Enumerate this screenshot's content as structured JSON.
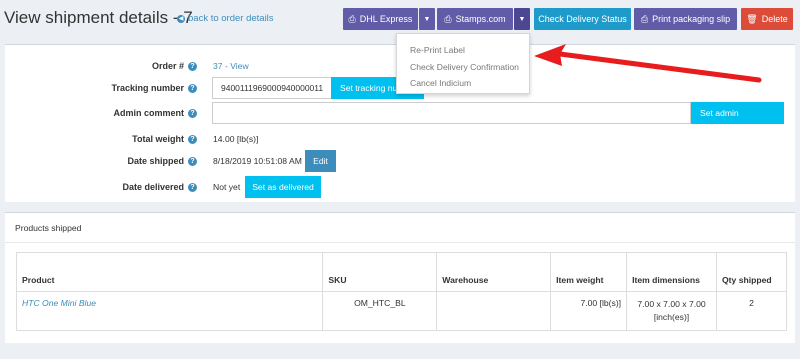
{
  "header": {
    "title": "View shipment details - 7",
    "back_link": "back to order details"
  },
  "toolbar": {
    "dhl": "DHL Express",
    "stamps": "Stamps.com",
    "check_delivery": "Check Delivery Status",
    "print_slip": "Print packaging slip",
    "delete": "Delete"
  },
  "dropdown": {
    "items": [
      "Re-Print Label",
      "Check Delivery Confirmation",
      "Cancel Indicium"
    ]
  },
  "details": {
    "order_label": "Order #",
    "order_value": "37 - View",
    "tracking_label": "Tracking number",
    "tracking_value": "9400111969000940000011",
    "tracking_btn": "Set tracking number",
    "admin_label": "Admin comment",
    "admin_value": "",
    "admin_btn": "Set admin comment",
    "weight_label": "Total weight",
    "weight_value": "14.00 [lb(s)]",
    "shipped_label": "Date shipped",
    "shipped_value": "8/18/2019 10:51:08 AM",
    "edit_btn": "Edit",
    "delivered_label": "Date delivered",
    "delivered_value": "Not yet",
    "delivered_btn": "Set as delivered"
  },
  "products": {
    "title": "Products shipped",
    "columns": [
      "Product",
      "SKU",
      "Warehouse",
      "Item weight",
      "Item dimensions",
      "Qty shipped"
    ],
    "rows": [
      {
        "product": "HTC One Mini Blue",
        "sku": "OM_HTC_BL",
        "warehouse": "",
        "weight": "7.00 [lb(s)]",
        "dimensions": "7.00 x 7.00 x 7.00 [inch(es)]",
        "qty": "2"
      }
    ]
  },
  "colors": {
    "accent_purple": "#605ca8",
    "teal": "#00c0ef",
    "blue": "#3c8dbc",
    "red": "#dd4b39",
    "arrow": "#e81c1c"
  }
}
